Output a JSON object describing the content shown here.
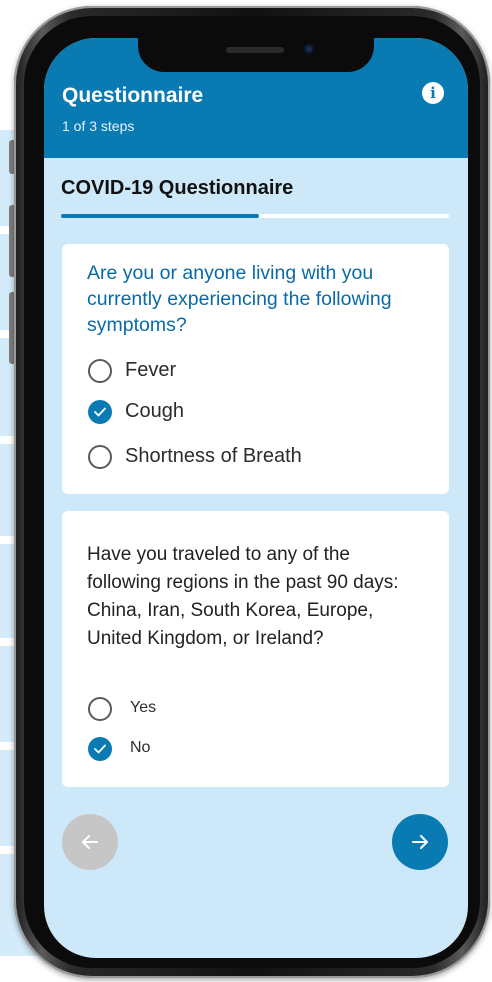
{
  "header": {
    "title": "Questionnaire",
    "steps": "1 of 3 steps",
    "info_icon": "info-icon"
  },
  "questionnaire": {
    "title": "COVID-19 Questionnaire",
    "progress": 0.51
  },
  "questions": [
    {
      "text": "Are you or anyone living with you currently experiencing the following symptoms?",
      "options": [
        {
          "label": "Fever",
          "checked": false
        },
        {
          "label": "Cough",
          "checked": true
        },
        {
          "label": "Shortness of Breath",
          "checked": false
        }
      ]
    },
    {
      "text": "Have you traveled to any of the following regions in the past 90 days: China, Iran, South Korea, Europe, United Kingdom, or Ireland?",
      "options": [
        {
          "label": "Yes",
          "checked": false
        },
        {
          "label": "No",
          "checked": true
        }
      ]
    }
  ],
  "navigation": {
    "prev_icon": "arrow-left-icon",
    "prev_enabled": false,
    "next_icon": "arrow-right-icon",
    "next_enabled": true
  },
  "colors": {
    "primary": "#0a7bb2",
    "screen_bg": "#cde8f8",
    "disabled": "#c6c6c6"
  }
}
